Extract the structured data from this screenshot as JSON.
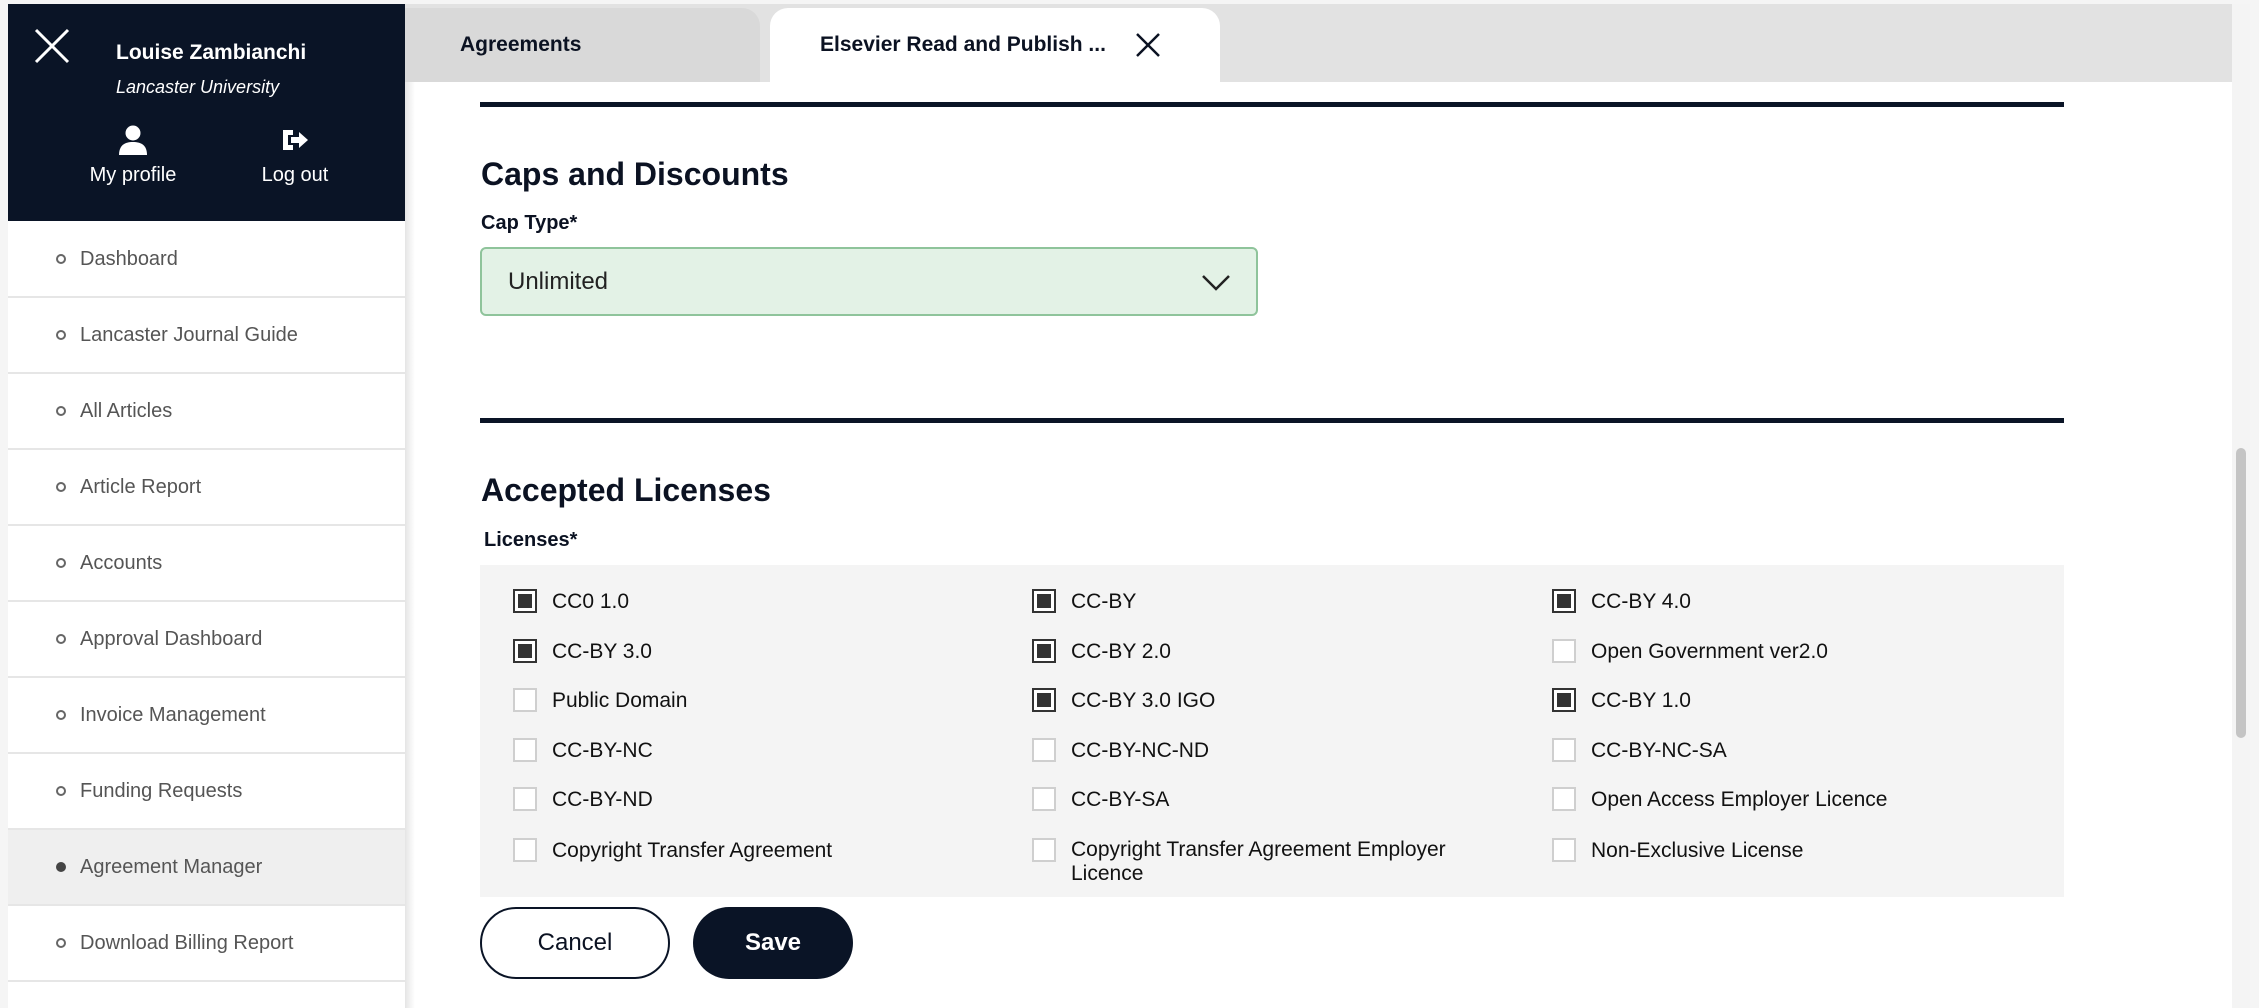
{
  "sidebar": {
    "user_name": "Louise Zambianchi",
    "user_org": "Lancaster University",
    "my_profile": "My profile",
    "log_out": "Log out",
    "items": [
      {
        "label": "Dashboard"
      },
      {
        "label": "Lancaster Journal Guide"
      },
      {
        "label": "All Articles"
      },
      {
        "label": "Article Report"
      },
      {
        "label": "Accounts"
      },
      {
        "label": "Approval Dashboard"
      },
      {
        "label": "Invoice Management"
      },
      {
        "label": "Funding Requests"
      },
      {
        "label": "Agreement Manager",
        "active": true
      },
      {
        "label": "Download Billing Report"
      }
    ]
  },
  "tabs": [
    {
      "label": "Agreements"
    },
    {
      "label": "Elsevier Read and Publish ..."
    }
  ],
  "caps": {
    "title": "Caps and Discounts",
    "cap_type_label": "Cap Type*",
    "cap_type_value": "Unlimited"
  },
  "licenses": {
    "title": "Accepted Licenses",
    "field_label": "Licenses*",
    "options": [
      {
        "label": "CC0 1.0",
        "checked": true
      },
      {
        "label": "CC-BY",
        "checked": true
      },
      {
        "label": "CC-BY 4.0",
        "checked": true
      },
      {
        "label": "CC-BY 3.0",
        "checked": true
      },
      {
        "label": "CC-BY 2.0",
        "checked": true
      },
      {
        "label": "Open Government ver2.0",
        "checked": false
      },
      {
        "label": "Public Domain",
        "checked": false
      },
      {
        "label": "CC-BY 3.0 IGO",
        "checked": true
      },
      {
        "label": "CC-BY 1.0",
        "checked": true
      },
      {
        "label": "CC-BY-NC",
        "checked": false
      },
      {
        "label": "CC-BY-NC-ND",
        "checked": false
      },
      {
        "label": "CC-BY-NC-SA",
        "checked": false
      },
      {
        "label": "CC-BY-ND",
        "checked": false
      },
      {
        "label": "CC-BY-SA",
        "checked": false
      },
      {
        "label": "Open Access Employer Licence",
        "checked": false
      },
      {
        "label": "Copyright Transfer Agreement",
        "checked": false
      },
      {
        "label": "Copyright Transfer Agreement Employer Licence",
        "checked": false
      },
      {
        "label": "Non-Exclusive License",
        "checked": false
      }
    ]
  },
  "actions": {
    "cancel": "Cancel",
    "save": "Save"
  },
  "colors": {
    "navy": "#0a1426",
    "select_bg": "#e3f2e6",
    "select_border": "#8fc49b"
  },
  "icons": [
    "close-icon",
    "user-icon",
    "logout-icon",
    "chevron-down-icon"
  ]
}
